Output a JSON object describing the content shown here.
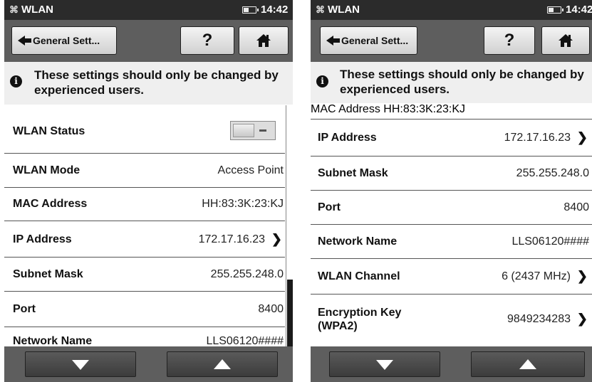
{
  "left": {
    "status_title": "WLAN",
    "time": "14:42",
    "back_label": "General Sett...",
    "help_label": "?",
    "warning": "These settings should only be changed by experienced users.",
    "rows": [
      {
        "label": "WLAN Status",
        "value": ""
      },
      {
        "label": "WLAN Mode",
        "value": "Access Point"
      },
      {
        "label": "MAC Address",
        "value": "HH:83:3K:23:KJ"
      },
      {
        "label": "IP Address",
        "value": "172.17.16.23"
      },
      {
        "label": "Subnet Mask",
        "value": "255.255.248.0"
      },
      {
        "label": "Port",
        "value": "8400"
      },
      {
        "label": "Network Name",
        "value": "LLS06120####"
      }
    ],
    "wlan_status_toggle": "off"
  },
  "right": {
    "status_title": "WLAN",
    "time": "14:42",
    "back_label": "General Sett...",
    "help_label": "?",
    "warning": "These settings should only be changed by experienced users.",
    "partial_label": "MAC Address",
    "partial_value": "HH:83:3K:23:KJ",
    "rows": [
      {
        "label": "IP Address",
        "value": "172.17.16.23"
      },
      {
        "label": "Subnet Mask",
        "value": "255.255.248.0"
      },
      {
        "label": "Port",
        "value": "8400"
      },
      {
        "label": "Network Name",
        "value": "LLS06120####"
      },
      {
        "label": "WLAN Channel",
        "value": "6 (2437 MHz)"
      },
      {
        "label": "Encryption Key (WPA2)",
        "value": "9849234283"
      }
    ]
  }
}
